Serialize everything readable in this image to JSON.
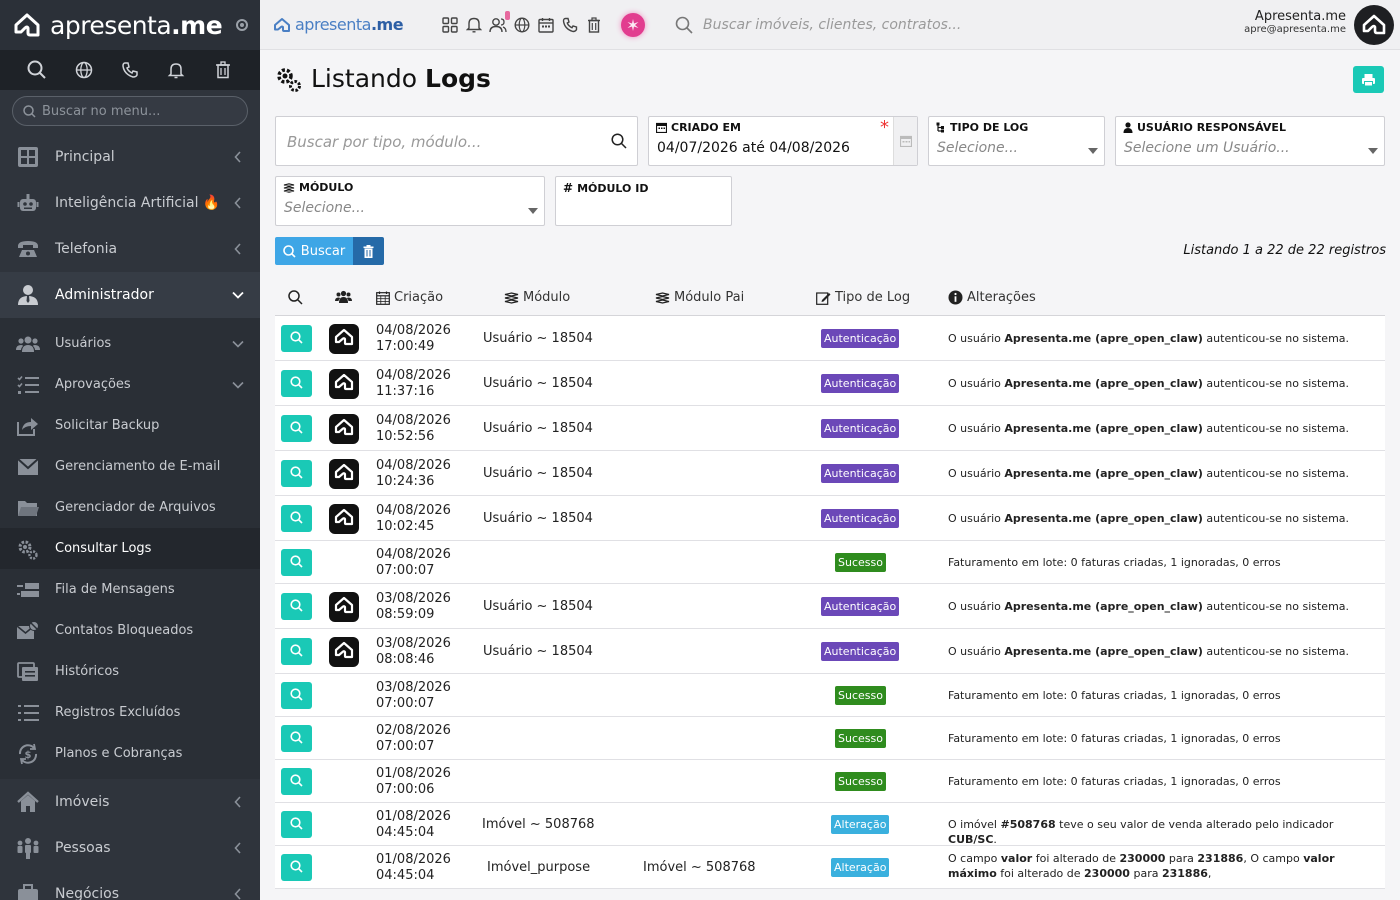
{
  "brand": {
    "name_light": "apresenta",
    "name_bold": ".me"
  },
  "sidebar": {
    "search_placeholder": "Buscar no menu...",
    "items": [
      {
        "label": "Principal",
        "icon": "dashboard-icon"
      },
      {
        "label": "Inteligência Artificial 🔥",
        "icon": "robot-icon"
      },
      {
        "label": "Telefonia",
        "icon": "phone-icon"
      },
      {
        "label": "Administrador",
        "icon": "user-tie-icon"
      }
    ],
    "sub_items": [
      {
        "label": "Usuários",
        "icon": "users-icon"
      },
      {
        "label": "Aprovações",
        "icon": "list-check-icon"
      },
      {
        "label": "Solicitar Backup",
        "icon": "share-icon"
      },
      {
        "label": "Gerenciamento de E-mail",
        "icon": "envelope-icon"
      },
      {
        "label": "Gerenciador de Arquivos",
        "icon": "folder-icon"
      },
      {
        "label": "Consultar Logs",
        "icon": "cogs-icon"
      },
      {
        "label": "Fila de Mensagens",
        "icon": "queue-icon"
      },
      {
        "label": "Contatos Bloqueados",
        "icon": "block-mail-icon"
      },
      {
        "label": "Históricos",
        "icon": "history-icon"
      },
      {
        "label": "Registros Excluídos",
        "icon": "list-icon"
      },
      {
        "label": "Planos e Cobranças",
        "icon": "dollar-cycle-icon"
      }
    ],
    "bottom_items": [
      {
        "label": "Imóveis",
        "icon": "home-icon"
      },
      {
        "label": "Pessoas",
        "icon": "people-icon"
      },
      {
        "label": "Negócios",
        "icon": "briefcase-icon"
      }
    ]
  },
  "topbar": {
    "logo_light": "apresenta",
    "logo_bold": ".me",
    "search_placeholder": "Buscar imóveis, clientes, contratos...",
    "user_name": "Apresenta.me",
    "user_email": "apre@apresenta.me"
  },
  "page": {
    "title_light": "Listando",
    "title_bold": "Logs",
    "search_placeholder": "Buscar por tipo, módulo...",
    "filters": {
      "criado_em_label": "CRIADO EM",
      "criado_em_value": "04/07/2026 até 04/08/2026",
      "tipo_label": "TIPO DE LOG",
      "tipo_placeholder": "Selecione...",
      "usuario_label": "USUÁRIO RESPONSÁVEL",
      "usuario_placeholder": "Selecione um Usuário...",
      "modulo_label": "MÓDULO",
      "modulo_placeholder": "Selecione...",
      "modulo_id_label": "MÓDULO ID"
    },
    "buscar_label": "Buscar",
    "count_text": "Listando 1 a 22 de 22 registros"
  },
  "table": {
    "headers": {
      "criacao": "Criação",
      "modulo": "Módulo",
      "modulo_pai": "Módulo Pai",
      "tipo": "Tipo de Log",
      "alteracoes": "Alterações"
    },
    "rows": [
      {
        "date": "04/08/2026",
        "time": "17:00:49",
        "modulo": "Usuário ~ 18504",
        "modulo_pai": "",
        "tipo": "Autenticação",
        "kind": "aut",
        "avatar": true,
        "chg_pre": "O usuário ",
        "chg_bold": "Apresenta.me (apre_open_claw)",
        "chg_post": " autenticou-se no sistema."
      },
      {
        "date": "04/08/2026",
        "time": "11:37:16",
        "modulo": "Usuário ~ 18504",
        "modulo_pai": "",
        "tipo": "Autenticação",
        "kind": "aut",
        "avatar": true,
        "chg_pre": "O usuário ",
        "chg_bold": "Apresenta.me (apre_open_claw)",
        "chg_post": " autenticou-se no sistema."
      },
      {
        "date": "04/08/2026",
        "time": "10:52:56",
        "modulo": "Usuário ~ 18504",
        "modulo_pai": "",
        "tipo": "Autenticação",
        "kind": "aut",
        "avatar": true,
        "chg_pre": "O usuário ",
        "chg_bold": "Apresenta.me (apre_open_claw)",
        "chg_post": " autenticou-se no sistema."
      },
      {
        "date": "04/08/2026",
        "time": "10:24:36",
        "modulo": "Usuário ~ 18504",
        "modulo_pai": "",
        "tipo": "Autenticação",
        "kind": "aut",
        "avatar": true,
        "chg_pre": "O usuário ",
        "chg_bold": "Apresenta.me (apre_open_claw)",
        "chg_post": " autenticou-se no sistema."
      },
      {
        "date": "04/08/2026",
        "time": "10:02:45",
        "modulo": "Usuário ~ 18504",
        "modulo_pai": "",
        "tipo": "Autenticação",
        "kind": "aut",
        "avatar": true,
        "chg_pre": "O usuário ",
        "chg_bold": "Apresenta.me (apre_open_claw)",
        "chg_post": " autenticou-se no sistema."
      },
      {
        "date": "04/08/2026",
        "time": "07:00:07",
        "modulo": "",
        "modulo_pai": "",
        "tipo": "Sucesso",
        "kind": "suc",
        "avatar": false,
        "chg_pre": "Faturamento em lote: 0 faturas criadas, 1 ignoradas, 0 erros",
        "chg_bold": "",
        "chg_post": ""
      },
      {
        "date": "03/08/2026",
        "time": "08:59:09",
        "modulo": "Usuário ~ 18504",
        "modulo_pai": "",
        "tipo": "Autenticação",
        "kind": "aut",
        "avatar": true,
        "chg_pre": "O usuário ",
        "chg_bold": "Apresenta.me (apre_open_claw)",
        "chg_post": " autenticou-se no sistema."
      },
      {
        "date": "03/08/2026",
        "time": "08:08:46",
        "modulo": "Usuário ~ 18504",
        "modulo_pai": "",
        "tipo": "Autenticação",
        "kind": "aut",
        "avatar": true,
        "chg_pre": "O usuário ",
        "chg_bold": "Apresenta.me (apre_open_claw)",
        "chg_post": " autenticou-se no sistema."
      },
      {
        "date": "03/08/2026",
        "time": "07:00:07",
        "modulo": "",
        "modulo_pai": "",
        "tipo": "Sucesso",
        "kind": "suc",
        "avatar": false,
        "chg_pre": "Faturamento em lote: 0 faturas criadas, 1 ignoradas, 0 erros",
        "chg_bold": "",
        "chg_post": ""
      },
      {
        "date": "02/08/2026",
        "time": "07:00:07",
        "modulo": "",
        "modulo_pai": "",
        "tipo": "Sucesso",
        "kind": "suc",
        "avatar": false,
        "chg_pre": "Faturamento em lote: 0 faturas criadas, 1 ignoradas, 0 erros",
        "chg_bold": "",
        "chg_post": ""
      },
      {
        "date": "01/08/2026",
        "time": "07:00:06",
        "modulo": "",
        "modulo_pai": "",
        "tipo": "Sucesso",
        "kind": "suc",
        "avatar": false,
        "chg_pre": "Faturamento em lote: 0 faturas criadas, 1 ignoradas, 0 erros",
        "chg_bold": "",
        "chg_post": ""
      },
      {
        "date": "01/08/2026",
        "time": "04:45:04",
        "modulo": "Imóvel ~ 508768",
        "modulo_pai": "",
        "tipo": "Alteração",
        "kind": "alt",
        "avatar": false,
        "chg_pre": "O imóvel ",
        "chg_bold": "#508768",
        "chg_post": " teve o seu valor de venda alterado pelo indicador ",
        "chg_bold2": "CUB/SC",
        "chg_post2": "."
      },
      {
        "date": "01/08/2026",
        "time": "04:45:04",
        "modulo": "Imóvel_purpose",
        "modulo_pai": "Imóvel ~ 508768",
        "tipo": "Alteração",
        "kind": "alt",
        "avatar": false,
        "chg_pre": "O campo ",
        "chg_bold": "valor",
        "chg_post": " foi alterado de ",
        "chg_bold2": "230000",
        "chg_post2": " para ",
        "chg_bold3": "231886",
        "chg_post3": ", O campo ",
        "chg_bold4": "valor máximo",
        "chg_post4": " foi alterado de ",
        "chg_bold5": "230000",
        "chg_post5": " para ",
        "chg_bold6": "231886",
        "chg_post6": ","
      }
    ]
  }
}
